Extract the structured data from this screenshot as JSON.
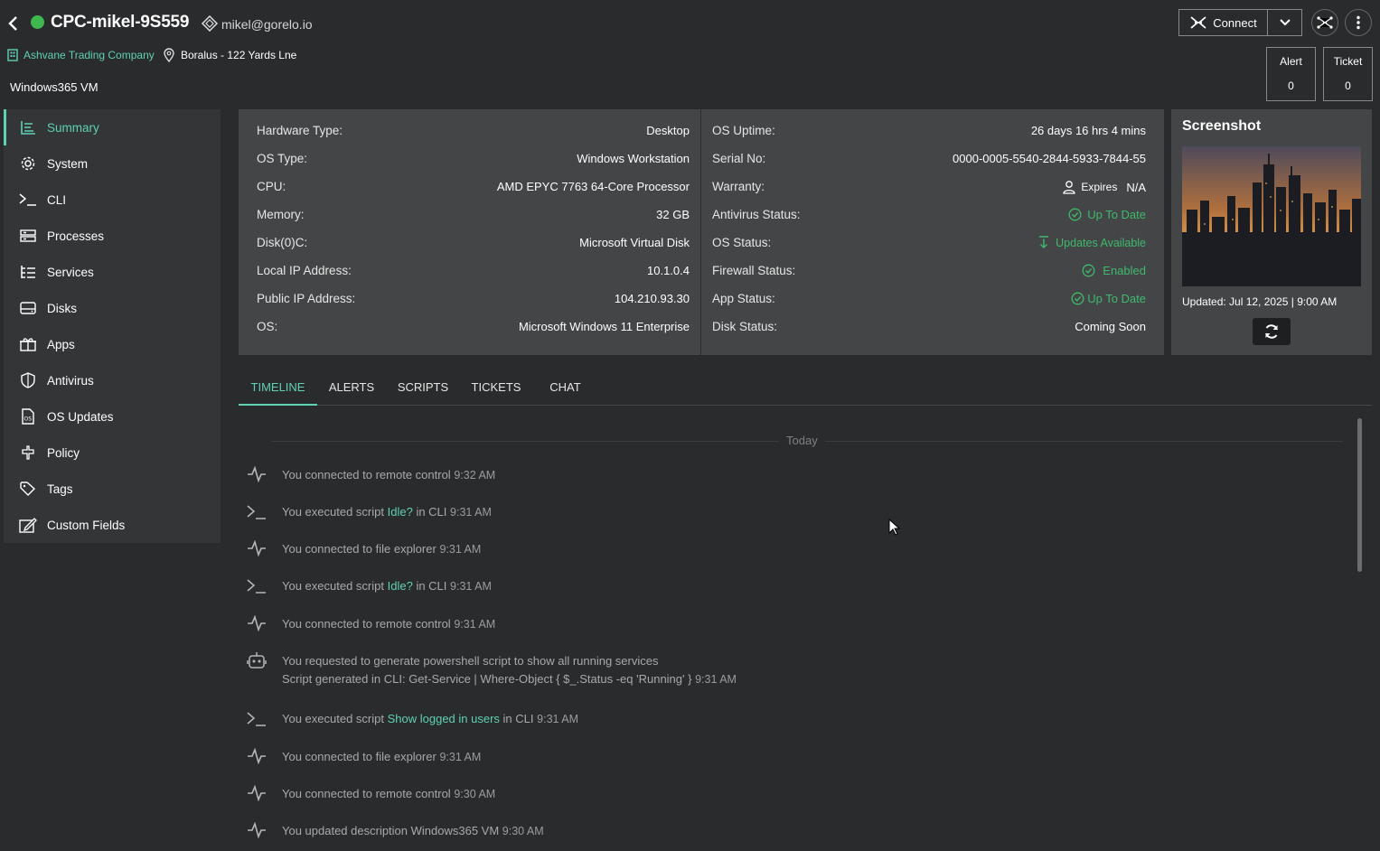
{
  "header": {
    "device_name": "CPC-mikel-9S559",
    "user_email": "mikel@gorelo.io",
    "company": "Ashvane Trading Company",
    "location": "Boralus - 122 Yards Lne",
    "vm_label": "Windows365 VM",
    "connect_label": "Connect",
    "status_color": "#3fb84f",
    "alert": {
      "label": "Alert",
      "count": "0"
    },
    "ticket": {
      "label": "Ticket",
      "count": "0"
    }
  },
  "sidebar": {
    "items": [
      {
        "label": "Summary",
        "icon": "summary-icon",
        "active": true
      },
      {
        "label": "System",
        "icon": "gear-icon"
      },
      {
        "label": "CLI",
        "icon": "terminal-icon"
      },
      {
        "label": "Processes",
        "icon": "processes-icon"
      },
      {
        "label": "Services",
        "icon": "services-icon"
      },
      {
        "label": "Disks",
        "icon": "disk-icon"
      },
      {
        "label": "Apps",
        "icon": "apps-icon"
      },
      {
        "label": "Antivirus",
        "icon": "shield-icon"
      },
      {
        "label": "OS Updates",
        "icon": "os-updates-icon"
      },
      {
        "label": "Policy",
        "icon": "policy-icon"
      },
      {
        "label": "Tags",
        "icon": "tag-icon"
      },
      {
        "label": "Custom Fields",
        "icon": "custom-fields-icon"
      }
    ]
  },
  "info_left": [
    {
      "key": "Hardware Type:",
      "value": "Desktop"
    },
    {
      "key": "OS Type:",
      "value": "Windows Workstation"
    },
    {
      "key": "CPU:",
      "value": "AMD EPYC 7763 64-Core Processor"
    },
    {
      "key": "Memory:",
      "value": "32 GB"
    },
    {
      "key": "Disk(0)C:",
      "value": "Microsoft Virtual Disk"
    },
    {
      "key": "Local IP Address:",
      "value": "10.1.0.4"
    },
    {
      "key": "Public IP Address:",
      "value": "104.210.93.30"
    },
    {
      "key": "OS:",
      "value": "Microsoft Windows 11 Enterprise"
    }
  ],
  "info_right": [
    {
      "key": "OS Uptime:",
      "value": "26 days 16 hrs 4 mins"
    },
    {
      "key": "Serial No:",
      "value": "0000-0005-5540-2844-5933-7844-55"
    },
    {
      "key": "Warranty:",
      "value_prefix": "Expires",
      "value": "N/A"
    },
    {
      "key": "Antivirus Status:",
      "value": "Up To Date"
    },
    {
      "key": "OS Status:",
      "value": "Updates Available"
    },
    {
      "key": "Firewall Status:",
      "value": "Enabled"
    },
    {
      "key": "App Status:",
      "value": "Up To Date"
    },
    {
      "key": "Disk Status:",
      "value": "Coming Soon"
    }
  ],
  "screenshot": {
    "title": "Screenshot",
    "updated": "Updated: Jul 12, 2025 | 9:00 AM"
  },
  "tabs": [
    "TIMELINE",
    "ALERTS",
    "SCRIPTS",
    "TICKETS",
    "CHAT"
  ],
  "timeline": {
    "day_label": "Today",
    "entries": [
      {
        "icon": "activity-icon",
        "pre": "You connected to remote control",
        "time": "9:32 AM"
      },
      {
        "icon": "terminal-icon",
        "pre": "You executed script",
        "link": "Idle?",
        "post": "in CLI",
        "time": "9:31 AM"
      },
      {
        "icon": "activity-icon",
        "pre": "You connected to file explorer",
        "time": "9:31 AM"
      },
      {
        "icon": "terminal-icon",
        "pre": "You executed script",
        "link": "Idle?",
        "post": "in CLI",
        "time": "9:31 AM"
      },
      {
        "icon": "activity-icon",
        "pre": "You connected to remote control",
        "time": "9:31 AM"
      },
      {
        "icon": "robot-icon",
        "pre": "You requested to generate powershell script to show all running services",
        "line2": "Script generated in CLI: Get-Service | Where-Object { $_.Status -eq 'Running' }",
        "time": "9:31 AM"
      },
      {
        "icon": "terminal-icon",
        "pre": "You executed script",
        "link": "Show logged in users",
        "post": "in CLI",
        "time": "9:31 AM"
      },
      {
        "icon": "activity-icon",
        "pre": "You connected to file explorer",
        "time": "9:31 AM"
      },
      {
        "icon": "activity-icon",
        "pre": "You connected to remote control",
        "time": "9:30 AM"
      },
      {
        "icon": "activity-icon",
        "pre": "You updated description Windows365 VM",
        "time": "9:30 AM"
      }
    ]
  },
  "colors": {
    "accent": "#5fd1b4",
    "ok_green": "#3fba6c",
    "panel": "#434547",
    "bg": "#2a2b2d"
  }
}
